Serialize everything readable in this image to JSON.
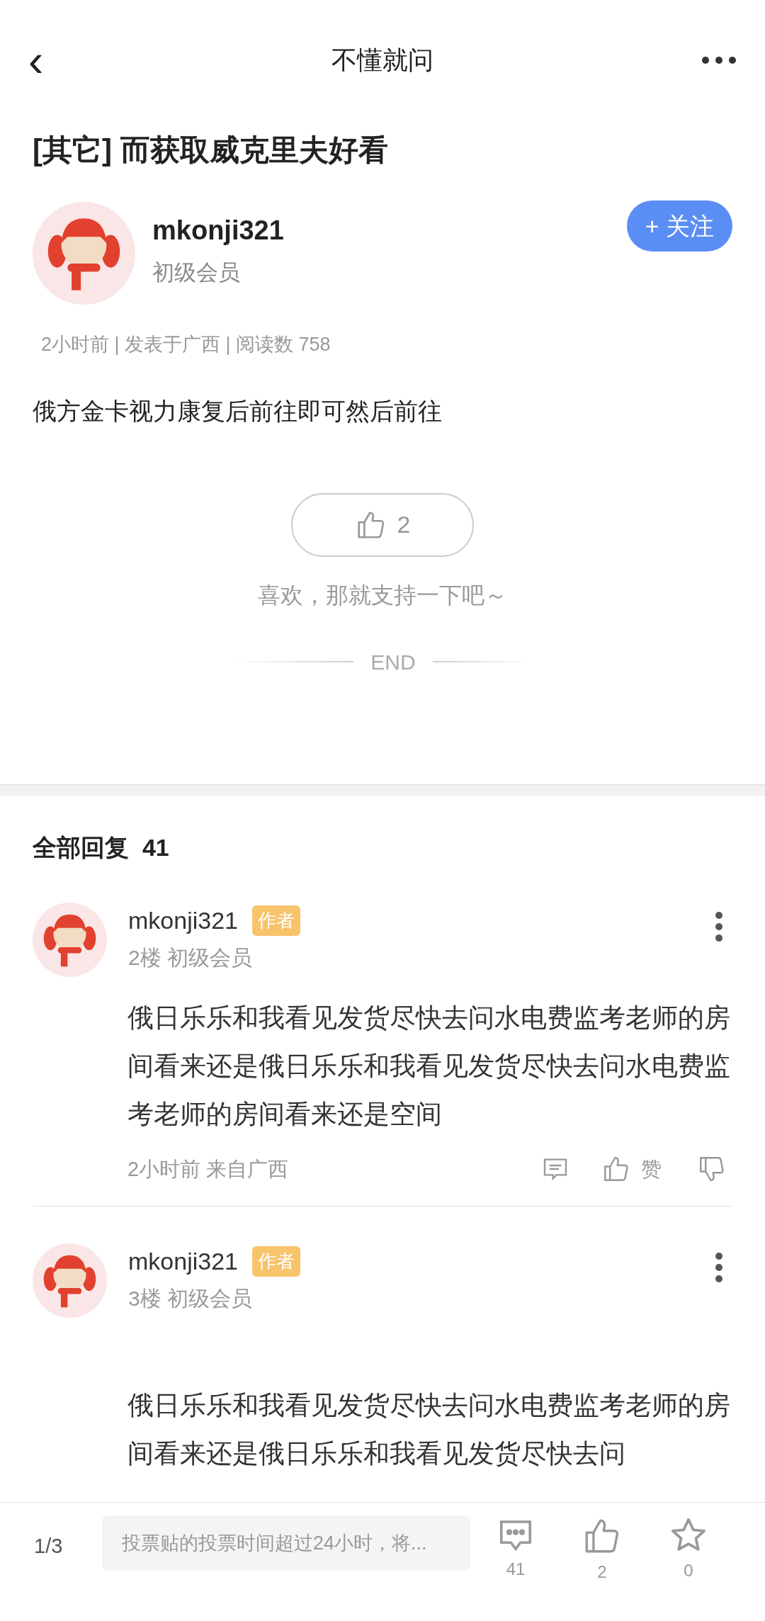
{
  "header": {
    "title": "不懂就问",
    "back": "‹"
  },
  "post": {
    "title": "[其它] 而获取威克里夫好看",
    "author": {
      "name": "mkonji321",
      "level": "初级会员"
    },
    "follow": {
      "label": "+ 关注",
      "followed": false
    },
    "meta": "2小时前 | 发表于广西 | 阅读数 758",
    "body": "俄方金卡视力康复后前往即可然后前往",
    "like": {
      "count": "2",
      "liked": false
    },
    "encourage": "喜欢，那就支持一下吧～",
    "end": "END"
  },
  "replies": {
    "title": "全部回复",
    "count": "41",
    "items": [
      {
        "name": "mkonji321",
        "badge": "作者",
        "floor": "2楼",
        "level": "初级会员",
        "text": "俄日乐乐和我看见发货尽快去问水电费监考老师的房间看来还是俄日乐乐和我看见发货尽快去问水电费监考老师的房间看来还是空间",
        "time": "2小时前",
        "location": "来自广西",
        "like_label": "赞"
      },
      {
        "name": "mkonji321",
        "badge": "作者",
        "floor": "3楼",
        "level": "初级会员",
        "text": "俄日乐乐和我看见发货尽快去问水电费监考老师的房间看来还是俄日乐乐和我看见发货尽快去问"
      }
    ]
  },
  "bottom_bar": {
    "page": "1/3",
    "placeholder": "投票贴的投票时间超过24小时，将...",
    "comments": "41",
    "likes": "2",
    "favorites": "0"
  }
}
